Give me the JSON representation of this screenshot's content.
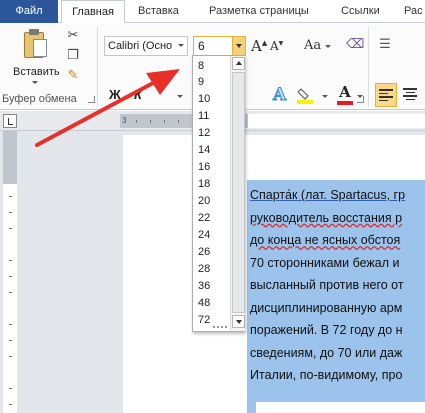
{
  "tabs": [
    {
      "label": "Файл"
    },
    {
      "label": "Главная"
    },
    {
      "label": "Вставка"
    },
    {
      "label": "Разметка страницы"
    },
    {
      "label": "Ссылки"
    },
    {
      "label": "Рас"
    }
  ],
  "clipboard": {
    "paste_label": "Вставить",
    "group_label": "Буфер обмена"
  },
  "font": {
    "name_value": "Calibri (Осно",
    "size_value": "6",
    "bold_label": "Ж",
    "italic_label": "К",
    "grow_label": "A",
    "change_case_label": "Aa",
    "text_effect_label": "A",
    "font_color_label": "A"
  },
  "size_options": [
    "8",
    "9",
    "10",
    "11",
    "12",
    "14",
    "16",
    "18",
    "20",
    "22",
    "24",
    "26",
    "28",
    "36",
    "48",
    "72"
  ],
  "document": {
    "lines": [
      "Спарта́к (лат. Spartacus, гр",
      "руководитель  восстания р",
      "до конца не ясных обстоя",
      "70 сторонниками бежал и",
      "высланный против него от",
      "дисциплинированную арм",
      "поражений. В 72 году до н",
      "сведениям, до 70 или даж",
      "Италии, по-видимому,  про"
    ]
  },
  "colors": {
    "file_tab": "#2b579a",
    "selection": "#9cc3eb",
    "arrow": "#e8302a",
    "highlight_button": "#fcd98a"
  }
}
